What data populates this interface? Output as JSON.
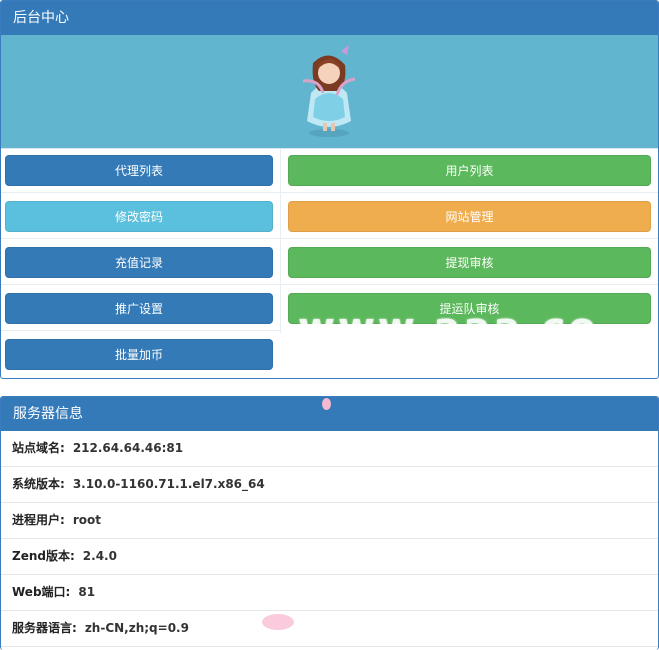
{
  "admin": {
    "title": "后台中心",
    "buttons": [
      {
        "label": "代理列表",
        "style": "primary"
      },
      {
        "label": "用户列表",
        "style": "success"
      },
      {
        "label": "修改密码",
        "style": "info"
      },
      {
        "label": "网站管理",
        "style": "warning"
      },
      {
        "label": "充值记录",
        "style": "primary"
      },
      {
        "label": "提现审核",
        "style": "success"
      },
      {
        "label": "推广设置",
        "style": "primary"
      },
      {
        "label": "提运队审核",
        "style": "success"
      },
      {
        "label": "批量加币",
        "style": "primary"
      }
    ],
    "watermark": "www.aaa.co"
  },
  "server": {
    "title": "服务器信息",
    "rows": [
      {
        "key": "站点域名:",
        "value": "212.64.64.46:81"
      },
      {
        "key": "系统版本:",
        "value": "3.10.0-1160.71.1.el7.x86_64"
      },
      {
        "key": "进程用户:",
        "value": "root"
      },
      {
        "key": "Zend版本:",
        "value": "2.4.0"
      },
      {
        "key": "Web端口:",
        "value": "81"
      },
      {
        "key": "服务器语言:",
        "value": "zh-CN,zh;q=0.9"
      }
    ]
  },
  "colors": {
    "primary": "#337ab7",
    "success": "#5cb85c",
    "info": "#5bc0de",
    "warning": "#f0ad4e",
    "heading": "#347ab9",
    "avatar_bg": "#62b5cf"
  },
  "icons": {
    "avatar": "character-avatar-icon"
  }
}
